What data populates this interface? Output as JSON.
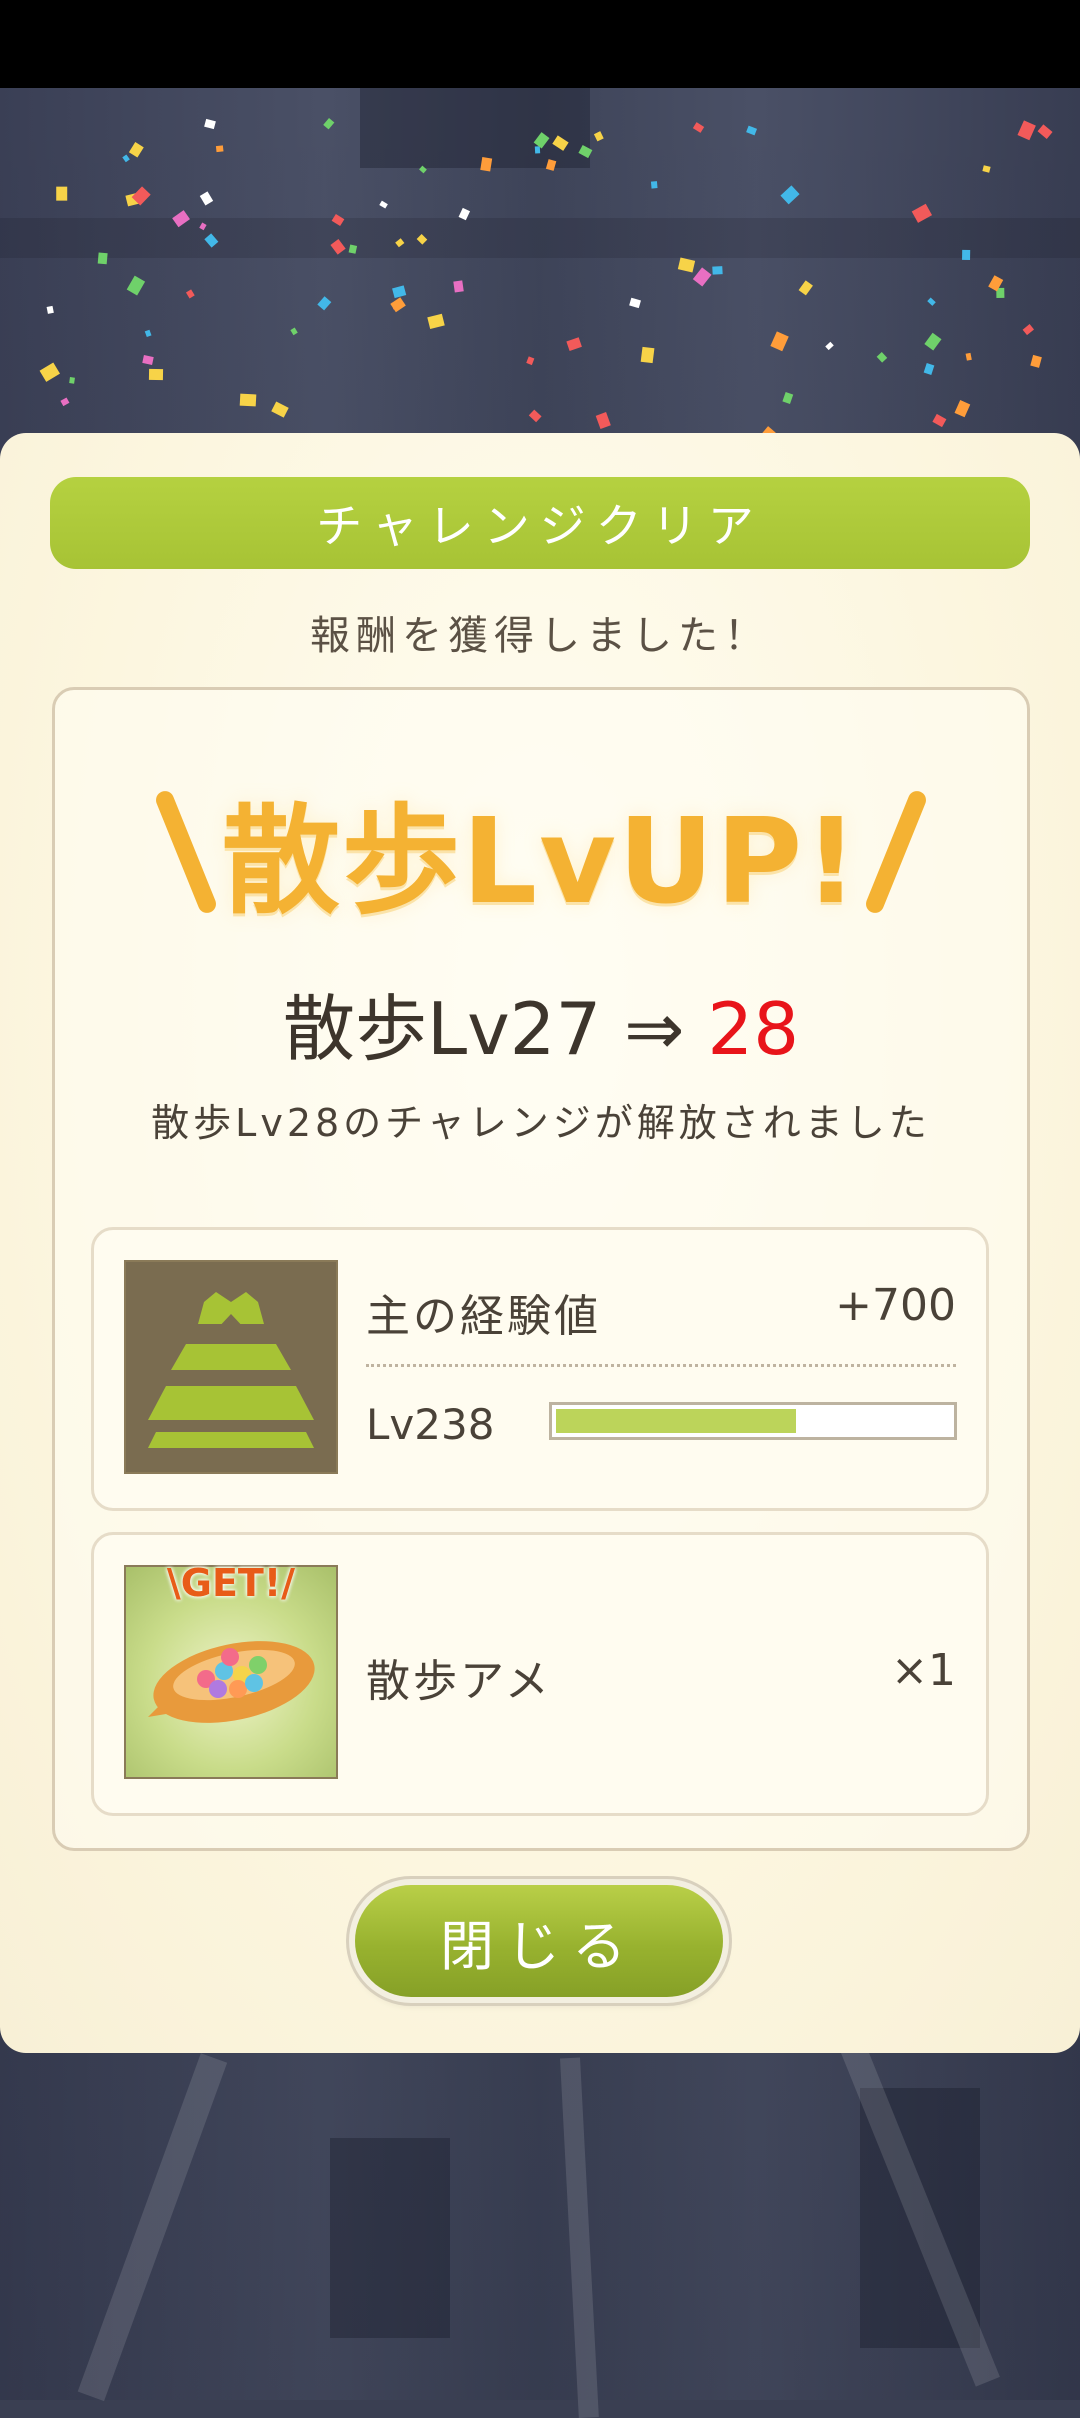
{
  "dialog": {
    "header": "チャレンジクリア",
    "subtitle": "報酬を獲得しました！",
    "title": "散歩LvUP!",
    "level_change": {
      "prefix": "散歩Lv27 ⇒ ",
      "new_level": "28"
    },
    "message": "散歩Lv28のチャレンジが解放されました",
    "rewards": [
      {
        "name": "主の経験値",
        "amount": "+700",
        "level": "Lv238",
        "exp_progress": 0.61
      },
      {
        "name": "散歩アメ",
        "amount": "×1",
        "badge": "\\GET!/"
      }
    ],
    "close_label": "閉じる"
  },
  "colors": {
    "accent_green": "#a7c335",
    "title_orange": "#f4b233",
    "new_level_red": "#e8141a",
    "panel_bg": "#fcf6df"
  },
  "icons": [
    "castle-icon",
    "candy-icon"
  ]
}
